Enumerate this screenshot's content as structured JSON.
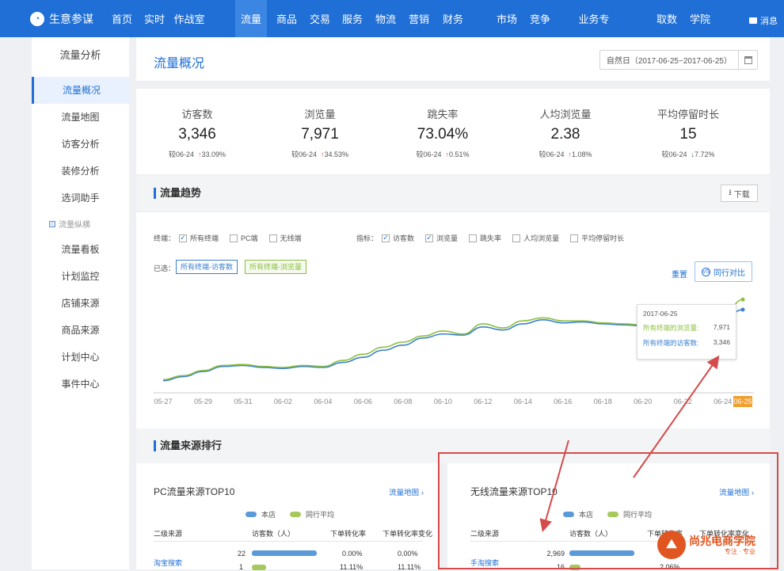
{
  "nav": {
    "brand": "生意参谋",
    "items": [
      {
        "label": "首页",
        "x": 141
      },
      {
        "label": "实时",
        "x": 182
      },
      {
        "label": "作战室",
        "x": 226
      },
      {
        "label": "流量",
        "x": 304,
        "active": true
      },
      {
        "label": "商品",
        "x": 349
      },
      {
        "label": "交易",
        "x": 391
      },
      {
        "label": "服务",
        "x": 432
      },
      {
        "label": "物流",
        "x": 474
      },
      {
        "label": "营销",
        "x": 516
      },
      {
        "label": "财务",
        "x": 559
      },
      {
        "label": "市场",
        "x": 627
      },
      {
        "label": "竞争",
        "x": 669
      },
      {
        "label": "业务专区",
        "x": 737
      },
      {
        "label": "取数",
        "x": 829
      },
      {
        "label": "学院",
        "x": 871
      }
    ],
    "message": "消息"
  },
  "sidebar": {
    "title": "流量分析",
    "items": [
      {
        "label": "流量概况",
        "active": true
      },
      {
        "label": "流量地图"
      },
      {
        "label": "访客分析"
      },
      {
        "label": "装修分析"
      },
      {
        "label": "选词助手"
      }
    ],
    "group": "流量纵横",
    "group_items": [
      "流量看板",
      "计划监控",
      "店铺来源",
      "商品来源",
      "计划中心",
      "事件中心"
    ]
  },
  "page": {
    "title": "流量概况",
    "date_range": "自然日（2017-06-25~2017-06-25）"
  },
  "kpis": [
    {
      "label": "访客数",
      "value": "3,346",
      "cmp": "较06-24",
      "dir": "up",
      "change": "33.09%"
    },
    {
      "label": "浏览量",
      "value": "7,971",
      "cmp": "较06-24",
      "dir": "up",
      "change": "34.53%"
    },
    {
      "label": "跳失率",
      "value": "73.04%",
      "cmp": "较06-24",
      "dir": "up",
      "change": "0.51%"
    },
    {
      "label": "人均浏览量",
      "value": "2.38",
      "cmp": "较06-24",
      "dir": "up",
      "change": "1.08%"
    },
    {
      "label": "平均停留时长",
      "value": "15",
      "cmp": "较06-24",
      "dir": "down",
      "change": "7.72%"
    }
  ],
  "trend": {
    "title": "流量趋势",
    "download": "下载",
    "terminal_label": "终端：",
    "terminals": [
      {
        "label": "所有终端",
        "checked": true
      },
      {
        "label": "PC端",
        "checked": false
      },
      {
        "label": "无线端",
        "checked": false
      }
    ],
    "metric_label": "指标：",
    "metrics": [
      {
        "label": "访客数",
        "checked": true
      },
      {
        "label": "浏览量",
        "checked": true
      },
      {
        "label": "跳失率",
        "checked": false
      },
      {
        "label": "人均浏览量",
        "checked": false
      },
      {
        "label": "平均停留时长",
        "checked": false
      }
    ],
    "selected_label": "已选：",
    "chips": [
      "所有终端-访客数",
      "所有终端-浏览量"
    ],
    "reset": "重置",
    "compare": "同行对比",
    "tooltip": {
      "date": "2017-06-25",
      "rows": [
        {
          "label": "所有终端的浏览量:",
          "value": "7,971",
          "color": "#8cbf3f"
        },
        {
          "label": "所有终端的访客数:",
          "value": "3,346",
          "color": "#3a7fcf"
        }
      ]
    }
  },
  "chart_data": {
    "type": "line",
    "x": [
      "05-27",
      "05-28",
      "05-29",
      "05-30",
      "05-31",
      "06-01",
      "06-02",
      "06-03",
      "06-04",
      "06-05",
      "06-06",
      "06-07",
      "06-08",
      "06-09",
      "06-10",
      "06-11",
      "06-12",
      "06-13",
      "06-14",
      "06-15",
      "06-16",
      "06-17",
      "06-18",
      "06-19",
      "06-20",
      "06-21",
      "06-22",
      "06-23",
      "06-24",
      "06-25"
    ],
    "tick_labels": [
      "05-27",
      "05-29",
      "05-31",
      "06-02",
      "06-04",
      "06-06",
      "06-08",
      "06-10",
      "06-12",
      "06-14",
      "06-16",
      "06-18",
      "06-20",
      "06-22",
      "06-24",
      "06-25"
    ],
    "series": [
      {
        "name": "所有终端-访客数",
        "color": "#3a7fcf",
        "values": [
          0.12,
          0.16,
          0.21,
          0.26,
          0.27,
          0.25,
          0.24,
          0.26,
          0.25,
          0.3,
          0.35,
          0.42,
          0.47,
          0.54,
          0.58,
          0.57,
          0.65,
          0.62,
          0.68,
          0.72,
          0.69,
          0.7,
          0.68,
          0.67,
          0.66,
          0.68,
          0.7,
          0.69,
          0.72,
          0.82
        ]
      },
      {
        "name": "所有终端-浏览量",
        "color": "#8cbf3f",
        "values": [
          0.13,
          0.17,
          0.22,
          0.27,
          0.28,
          0.26,
          0.25,
          0.27,
          0.26,
          0.32,
          0.38,
          0.45,
          0.5,
          0.56,
          0.61,
          0.58,
          0.68,
          0.64,
          0.71,
          0.74,
          0.71,
          0.71,
          0.69,
          0.68,
          0.67,
          0.69,
          0.71,
          0.7,
          0.74,
          0.92
        ]
      }
    ],
    "grid": false
  },
  "ranking": {
    "title": "流量来源排行",
    "pc": {
      "title": "PC流量来源TOP10",
      "link": "流量地图",
      "legend": [
        "本店",
        "同行平均"
      ],
      "headers": [
        "二级来源",
        "访客数（人）",
        "下单转化率",
        "下单转化率变化"
      ],
      "rows": [
        {
          "source": "淘宝搜索",
          "visitors": "22",
          "rate": "0.00%",
          "change": "0.00%"
        },
        {
          "source": "",
          "visitors": "1",
          "rate": "11.11%",
          "change": "11.11%"
        }
      ]
    },
    "wireless": {
      "title": "无线流量来源TOP10",
      "link": "流量地图",
      "legend": [
        "本店",
        "同行平均"
      ],
      "headers": [
        "二级来源",
        "访客数（人）",
        "下单转化率",
        "下单转化率变化"
      ],
      "rows": [
        {
          "source": "手淘搜索",
          "visitors": "2,969",
          "rate": "",
          "change": ""
        },
        {
          "source": "",
          "visitors": "16",
          "rate": "2.06%",
          "change": ""
        }
      ]
    }
  },
  "watermark": {
    "text": "尚兆电商学院",
    "sub": "专注 · 专业"
  }
}
